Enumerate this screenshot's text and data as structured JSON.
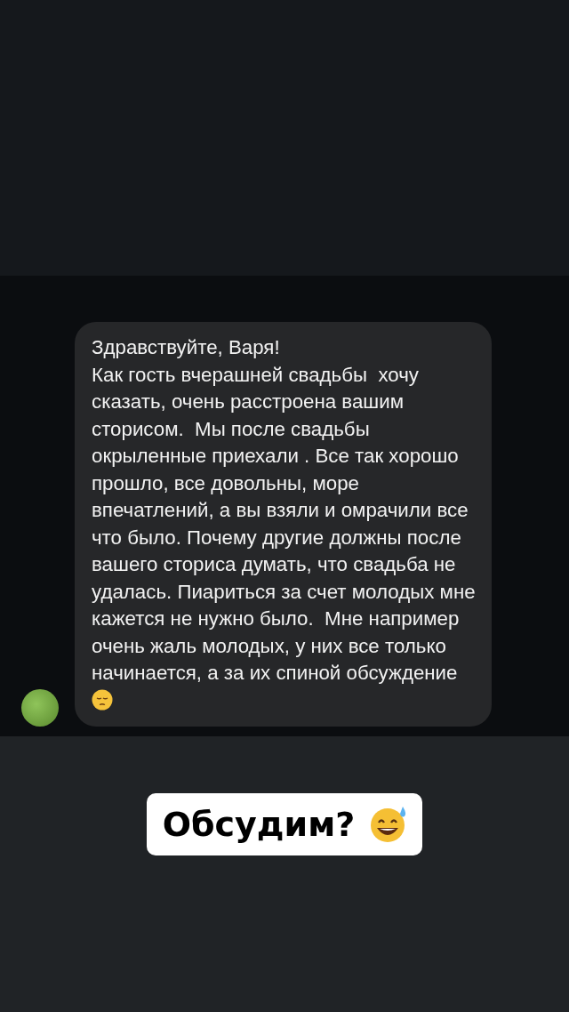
{
  "message": {
    "greeting": "Здравствуйте, Варя!",
    "body": "Как гость вчерашней свадьбы  хочу сказать, очень расстроена вашим сторисом.  Мы после свадьбы окрыленные приехали . Все так хорошо прошло, все довольны, море впечатлений, а вы взяли и омрачили все что было. Почему другие должны после вашего сториса думать, что свадьба не удалась. Пиариться за счет молодых мне кажется не нужно было.  Мне например  очень жаль молодых, у них все только начинается, а за их спиной обсуждение"
  },
  "sticker": {
    "text": "Обсудим?"
  }
}
